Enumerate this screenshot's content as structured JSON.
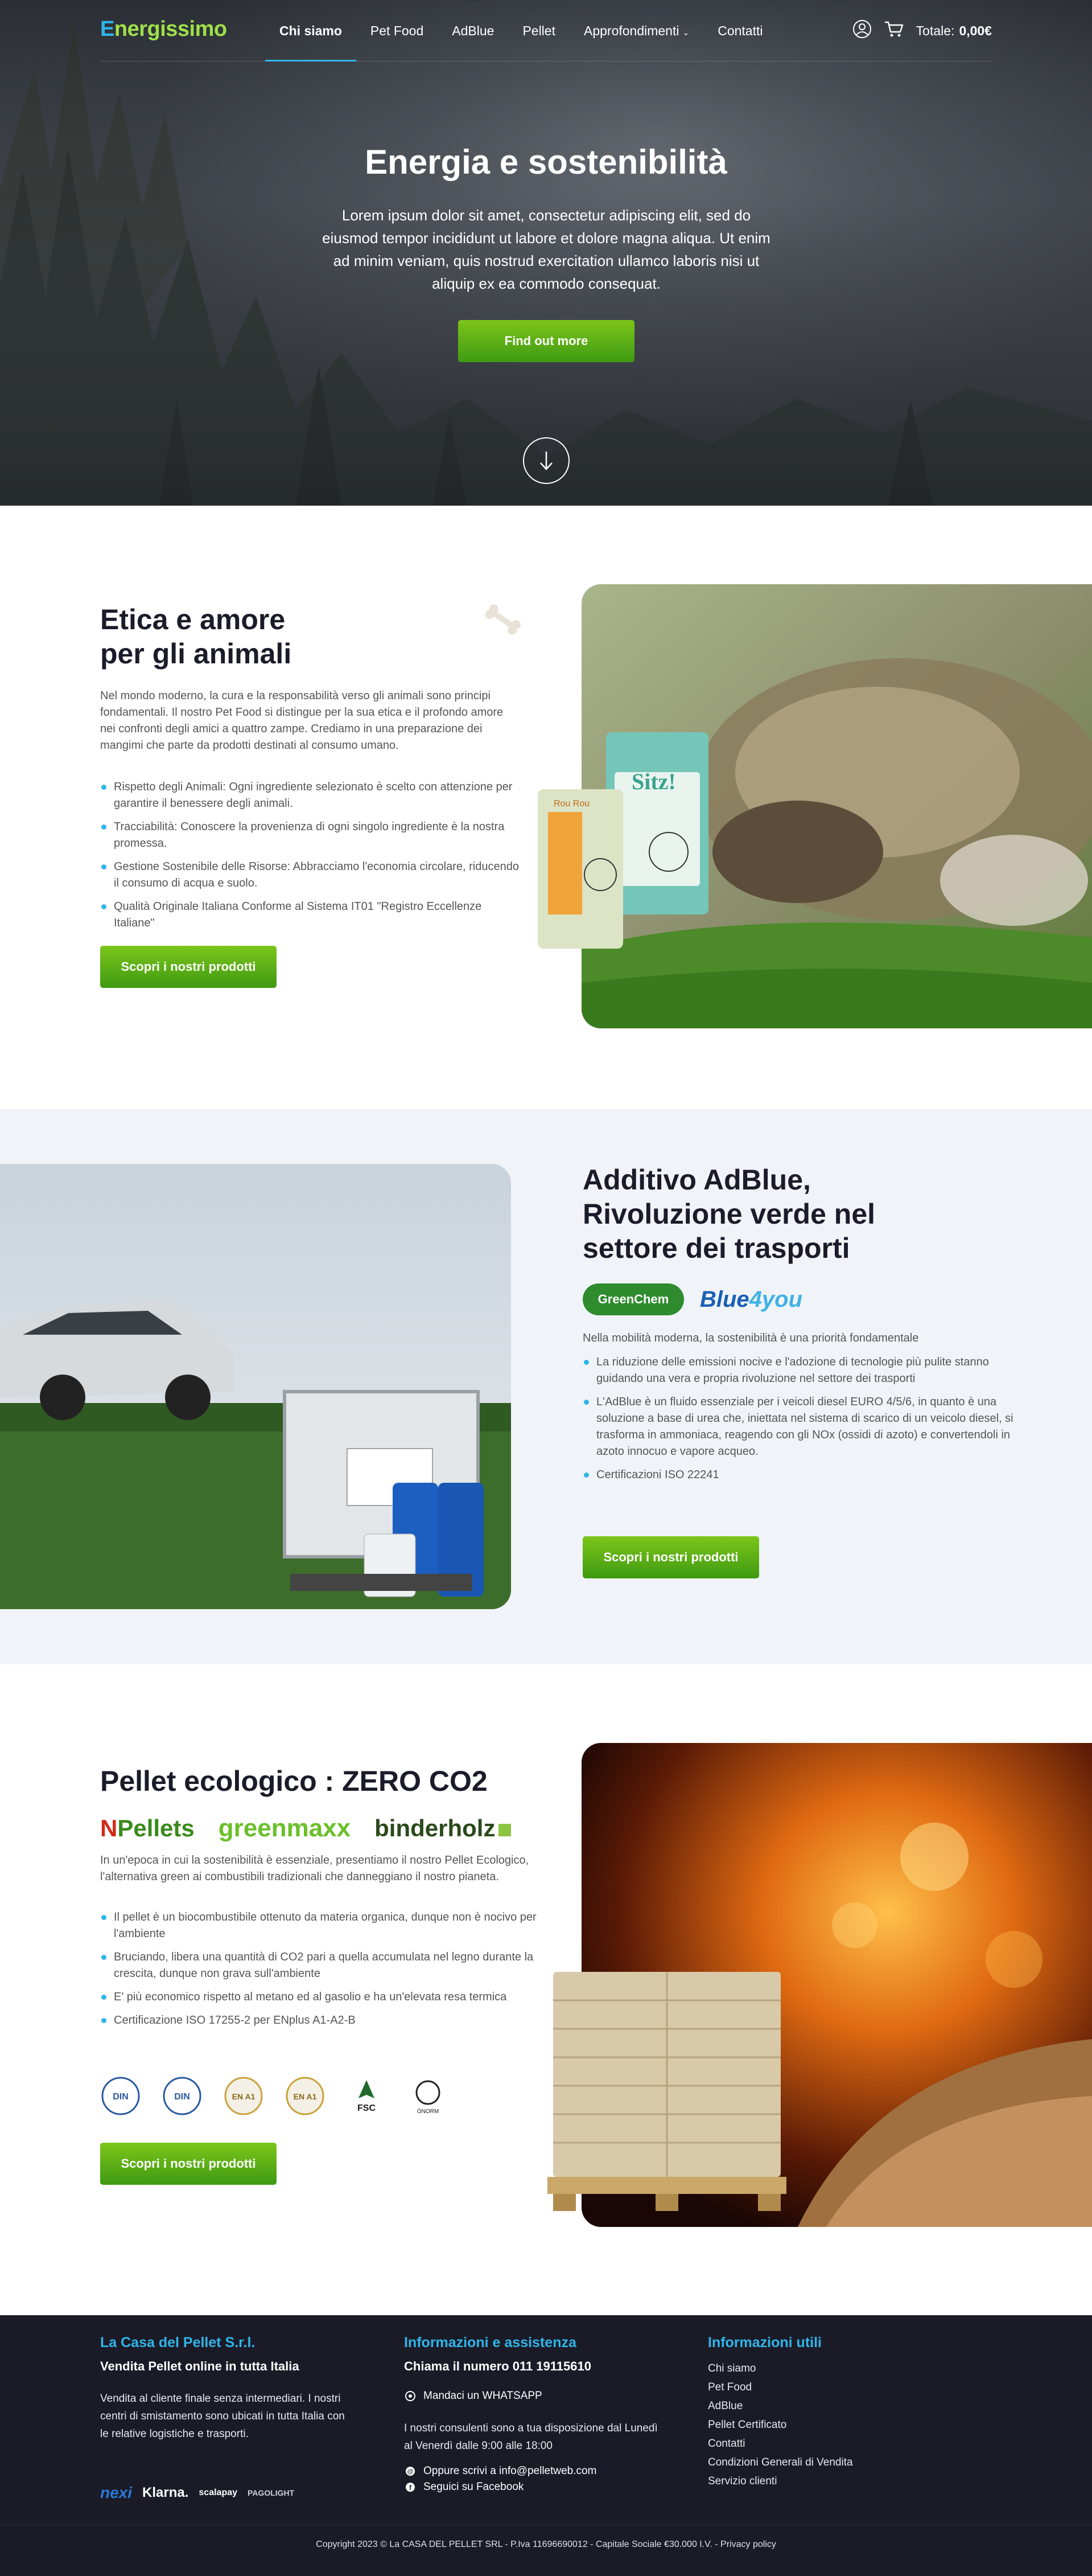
{
  "brand": {
    "logo_first": "E",
    "logo_rest": "nergissimo"
  },
  "nav": {
    "items": [
      {
        "label": "Chi siamo",
        "active": true
      },
      {
        "label": "Pet Food",
        "active": false
      },
      {
        "label": "AdBlue",
        "active": false
      },
      {
        "label": "Pellet",
        "active": false
      },
      {
        "label": "Approfondimenti",
        "active": false,
        "has_dropdown": true
      },
      {
        "label": "Contatti",
        "active": false
      }
    ],
    "user_icon": "user-circle-icon",
    "cart_icon": "cart-icon",
    "total_label": "Totale:",
    "total_value": "0,00€"
  },
  "hero": {
    "title": "Energia e sostenibilità",
    "text": "Lorem ipsum dolor sit amet, consectetur adipiscing elit, sed do eiusmod tempor incididunt ut labore et dolore magna aliqua. Ut enim ad minim veniam, quis nostrud exercitation ullamco laboris nisi ut aliquip ex ea commodo consequat.",
    "button": "Find out more",
    "scroll_icon": "arrow-down-icon"
  },
  "pets": {
    "title_line1": "Etica e amore",
    "title_line2": "per gli animali",
    "intro": "Nel mondo moderno, la cura e la responsabilità verso gli animali sono principi fondamentali. Il nostro Pet Food si distingue per la sua etica e il profondo amore nei confronti degli amici a quattro zampe. Crediamo in una preparazione dei mangimi che parte da prodotti destinati al consumo umano.",
    "bullets": [
      "Rispetto degli Animali: Ogni ingrediente selezionato è scelto con attenzione per garantire il benessere degli animali.",
      "Tracciabilità: Conoscere la provenienza di ogni singolo ingrediente è la nostra promessa.",
      "Gestione Sostenibile delle Risorse: Abbracciamo l'economia circolare, riducendo il consumo di acqua e suolo.",
      "Qualità Originale Italiana Conforme al Sistema IT01 \"Registro Eccellenze Italiane\""
    ],
    "button": "Scopri i nostri prodotti",
    "bag_labels": [
      "Rou Rou",
      "Sitz!"
    ]
  },
  "adblue": {
    "title_line1": "Additivo AdBlue,",
    "title_line2": "Rivoluzione verde nel",
    "title_line3": "settore dei trasporti",
    "logo_greenchem": "GreenChem",
    "logo_blue4you_a": "Blue",
    "logo_blue4you_b": "4you",
    "intro": "Nella mobilità moderna, la sostenibilità è una priorità fondamentale",
    "bullets": [
      "La riduzione delle emissioni nocive e l'adozione di tecnologie più pulite stanno guidando una vera e propria rivoluzione nel settore dei trasporti",
      "L'AdBlue è un fluido essenziale per i veicoli diesel EURO 4/5/6, in quanto è una soluzione a base di urea che, iniettata nel sistema di scarico di un veicolo diesel, si trasforma in ammoniaca, reagendo con gli NOx (ossidi di azoto) e convertendoli in azoto innocuo e vapore acqueo.",
      "Certificazioni ISO 22241"
    ],
    "button": "Scopri i nostri prodotti"
  },
  "pellet": {
    "title": "Pellet ecologico : ZERO CO2",
    "brand1_a": "Pellets",
    "brand1_mark": "N",
    "brand2": "greenmaxx",
    "brand3": "binderholz",
    "intro": "In un'epoca in cui la sostenibilità è essenziale, presentiamo il nostro Pellet Ecologico, l'alternativa green ai combustibili tradizionali che danneggiano il nostro pianeta.",
    "bullets": [
      "Il pellet è un biocombustibile ottenuto da materia organica, dunque non è nocivo per l'ambiente",
      "Bruciando, libera una quantità di CO2 pari a quella accumulata nel legno durante la crescita, dunque non grava sull'ambiente",
      "E' più economico rispetto al metano ed al gasolio e ha un'elevata resa termica",
      "Certificazione ISO 17255-2 per ENplus A1-A2-B"
    ],
    "certs": [
      {
        "name": "din-plus-icon",
        "label": "DIN"
      },
      {
        "name": "din-geprueft-icon",
        "label": "DIN"
      },
      {
        "name": "enplus-a1-icon",
        "label": "EN A1"
      },
      {
        "name": "enplus-a1-2-icon",
        "label": "EN A1"
      },
      {
        "name": "fsc-icon",
        "label": "FSC"
      },
      {
        "name": "onorm-icon",
        "label": "ÖNORM"
      }
    ],
    "button": "Scopri i nostri prodotti"
  },
  "footer": {
    "col1": {
      "title": "La Casa del Pellet S.r.l.",
      "subtitle": "Vendita Pellet online in tutta Italia",
      "text": "Vendita al cliente finale senza intermediari. I nostri centri di smistamento sono ubicati in tutta Italia con le relative logistiche e trasporti.",
      "payments": [
        "nexi",
        "Klarna.",
        "scalapay",
        "PAGOLIGHT"
      ]
    },
    "col2": {
      "title": "Informazioni e assistenza",
      "subtitle": "Chiama il numero 011 19115610",
      "whatsapp": "Mandaci un WHATSAPP",
      "hours": "I nostri consulenti sono a tua disposizione dal Lunedì al Venerdì dalle 9:00 alle 18:00",
      "email": "Oppure scrivi a  info@pelletweb.com",
      "facebook": "Seguici su Facebook"
    },
    "col3": {
      "title": "Informazioni utili",
      "links": [
        "Chi siamo",
        "Pet Food",
        "AdBlue",
        "Pellet Certificato",
        "Contatti",
        "Condizioni Generali di Vendita",
        "Servizio clienti"
      ]
    },
    "copyright": "Copyright 2023 © La CASA DEL PELLET SRL - P.Iva 11696690012 - Capitale Sociale €30.000 I.V. - Privacy policy"
  },
  "colors": {
    "accent_blue": "#2fb6e8",
    "green_button": "#5cae16",
    "footer_bg": "#1b1b28",
    "section_alt_bg": "#f0f4f8"
  }
}
